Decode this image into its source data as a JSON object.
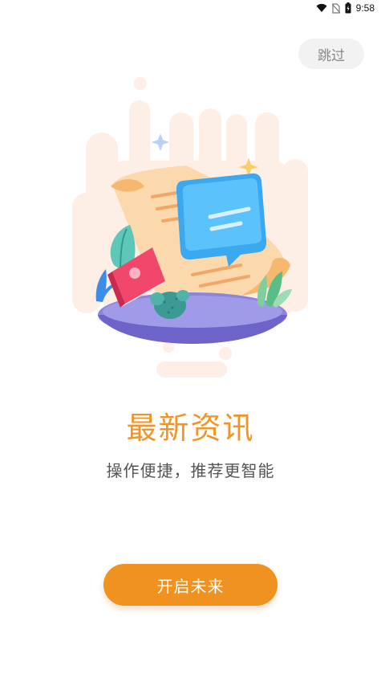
{
  "status_bar": {
    "time": "9:58",
    "icons": [
      "wifi-icon",
      "no-sim-icon",
      "battery-icon"
    ]
  },
  "skip_label": "跳过",
  "illustration": {
    "name": "news-illustration"
  },
  "headline": "最新资讯",
  "subtitle": "操作便捷，推荐更智能",
  "primary_button_label": "开启未来",
  "colors": {
    "accent": "#ef921f",
    "headline": "#f0952a",
    "skip_bg": "#f2f2f2",
    "skip_text": "#888888",
    "subtitle_text": "#555555"
  }
}
